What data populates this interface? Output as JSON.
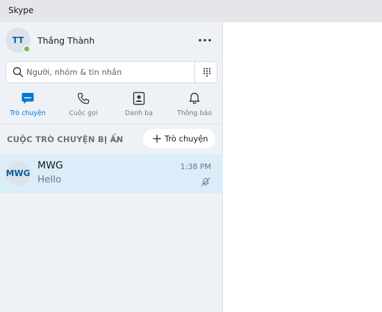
{
  "window": {
    "title": "Skype"
  },
  "profile": {
    "initials": "TT",
    "name": "Thắng Thành",
    "status_color": "#6cc04a"
  },
  "search": {
    "placeholder": "Người, nhóm & tin nhắn"
  },
  "tabs": [
    {
      "label": "Trò chuyện",
      "icon": "chat-icon",
      "active": true
    },
    {
      "label": "Cuộc gọi",
      "icon": "phone-icon",
      "active": false
    },
    {
      "label": "Danh bạ",
      "icon": "contacts-icon",
      "active": false
    },
    {
      "label": "Thông báo",
      "icon": "bell-icon",
      "active": false
    }
  ],
  "section": {
    "title": "CUỘC TRÒ CHUYỆN BỊ ẨN",
    "new_chat_label": "Trò chuyện"
  },
  "chats": [
    {
      "initials": "MWG",
      "name": "MWG",
      "preview": "Hello",
      "time": "1:38 PM",
      "muted": true
    }
  ],
  "colors": {
    "accent": "#0078d4",
    "selected_row": "#dbedf8",
    "sidebar_bg": "#eef2f7"
  }
}
